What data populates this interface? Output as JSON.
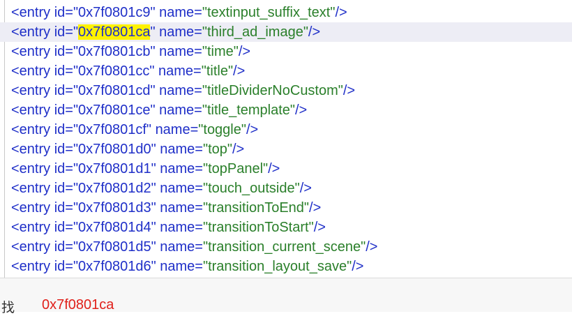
{
  "colors": {
    "tag": "#1f2fc8",
    "value": "#2a7f2a",
    "highlight": "#fff200",
    "find_query": "#e0201a"
  },
  "lines": [
    {
      "id": "0x7f0801c9",
      "name": "textinput_suffix_text"
    },
    {
      "id": "0x7f0801ca",
      "name": "third_ad_image"
    },
    {
      "id": "0x7f0801cb",
      "name": "time"
    },
    {
      "id": "0x7f0801cc",
      "name": "title"
    },
    {
      "id": "0x7f0801cd",
      "name": "titleDividerNoCustom"
    },
    {
      "id": "0x7f0801ce",
      "name": "title_template"
    },
    {
      "id": "0x7f0801cf",
      "name": "toggle"
    },
    {
      "id": "0x7f0801d0",
      "name": "top"
    },
    {
      "id": "0x7f0801d1",
      "name": "topPanel"
    },
    {
      "id": "0x7f0801d2",
      "name": "touch_outside"
    },
    {
      "id": "0x7f0801d3",
      "name": "transitionToEnd"
    },
    {
      "id": "0x7f0801d4",
      "name": "transitionToStart"
    },
    {
      "id": "0x7f0801d5",
      "name": "transition_current_scene"
    },
    {
      "id": "0x7f0801d6",
      "name": "transition_layout_save"
    }
  ],
  "syntax": {
    "open": "<entry id=",
    "name_attr": " name=",
    "close": "/>",
    "quote": "\""
  },
  "find": {
    "label": "找",
    "query": "0x7f0801ca"
  }
}
